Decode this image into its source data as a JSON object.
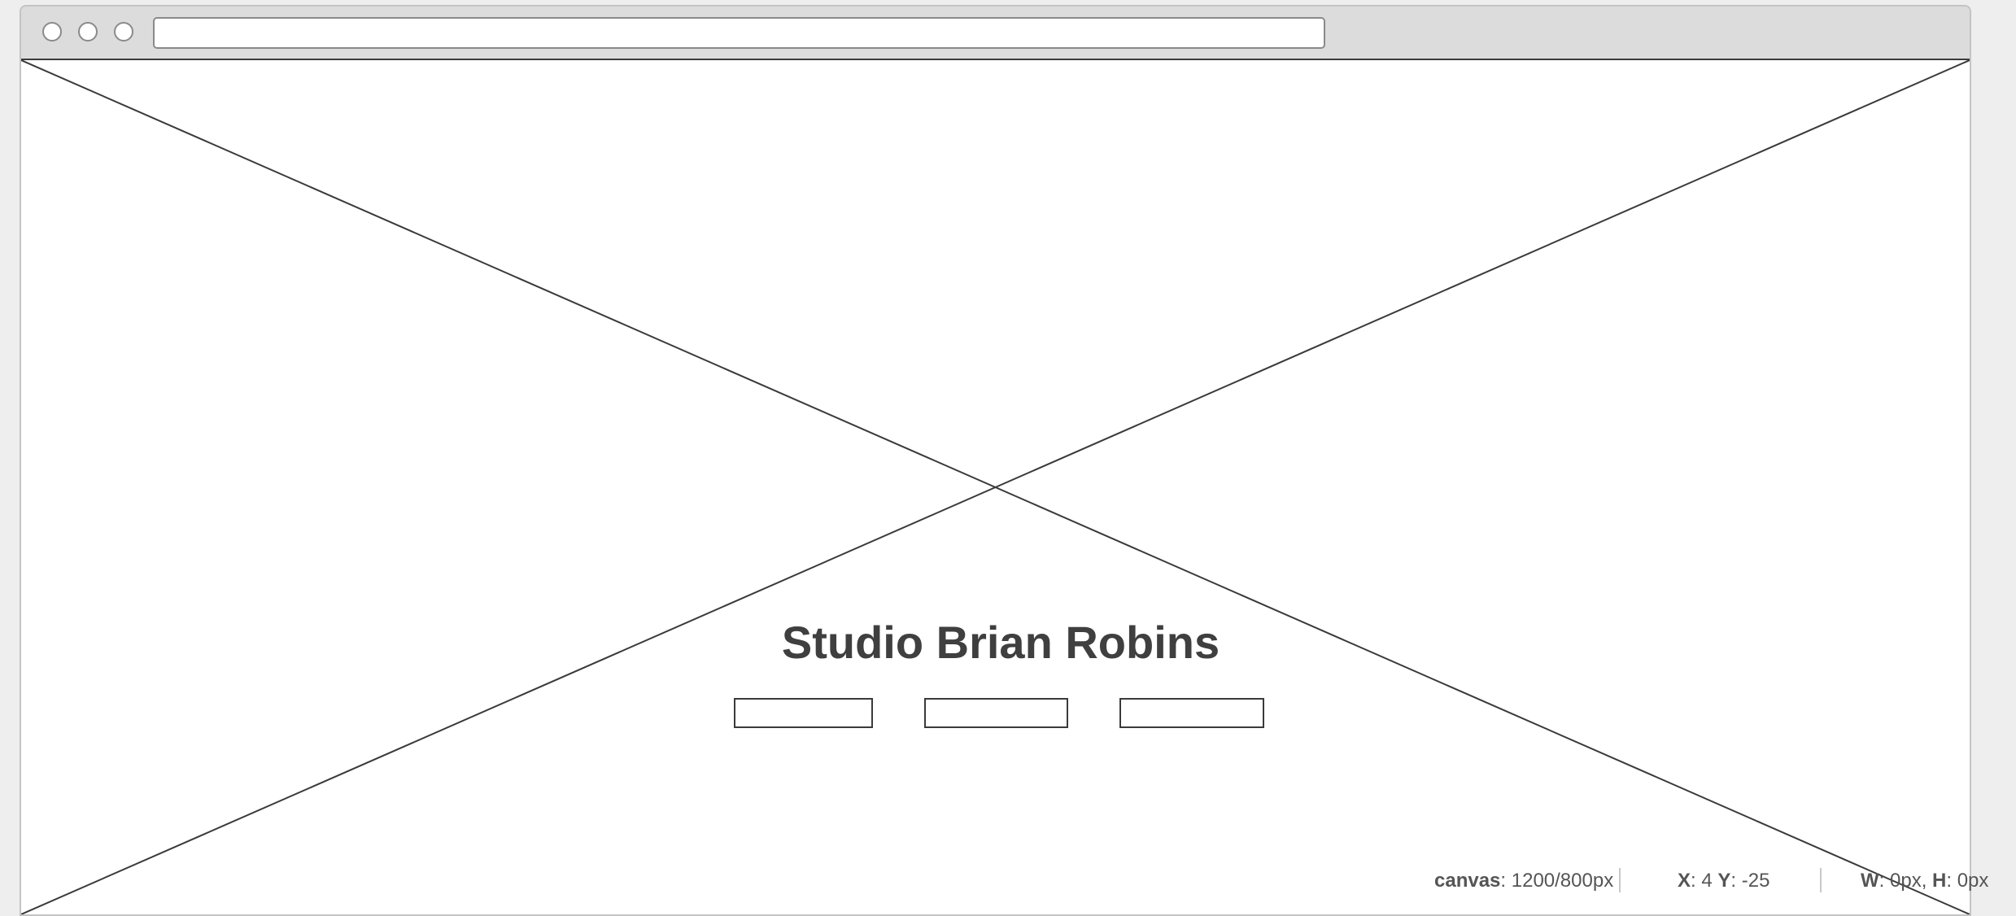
{
  "browser": {
    "address_bar": {
      "value": ""
    },
    "window_controls": [
      "close",
      "minimize",
      "maximize"
    ]
  },
  "page": {
    "title": "Studio Brian Robins",
    "nav_items": [
      {
        "label": ""
      },
      {
        "label": ""
      },
      {
        "label": ""
      }
    ],
    "hero_placeholder": "image-placeholder-icon"
  },
  "status_bar": {
    "canvas_label": "canvas",
    "canvas_value": ": 1200/800px",
    "x_label": "X",
    "x_value": ": 4 ",
    "y_label": "Y",
    "y_value": ": -25",
    "w_label": "W",
    "w_value": ": 0px, ",
    "h_label": "H",
    "h_value": ": 0px"
  },
  "colors": {
    "frame": "#dcdcdc",
    "stroke": "#3a3a3a",
    "title_text": "#3f3f3f",
    "canvas_bg": "#ffffff"
  }
}
